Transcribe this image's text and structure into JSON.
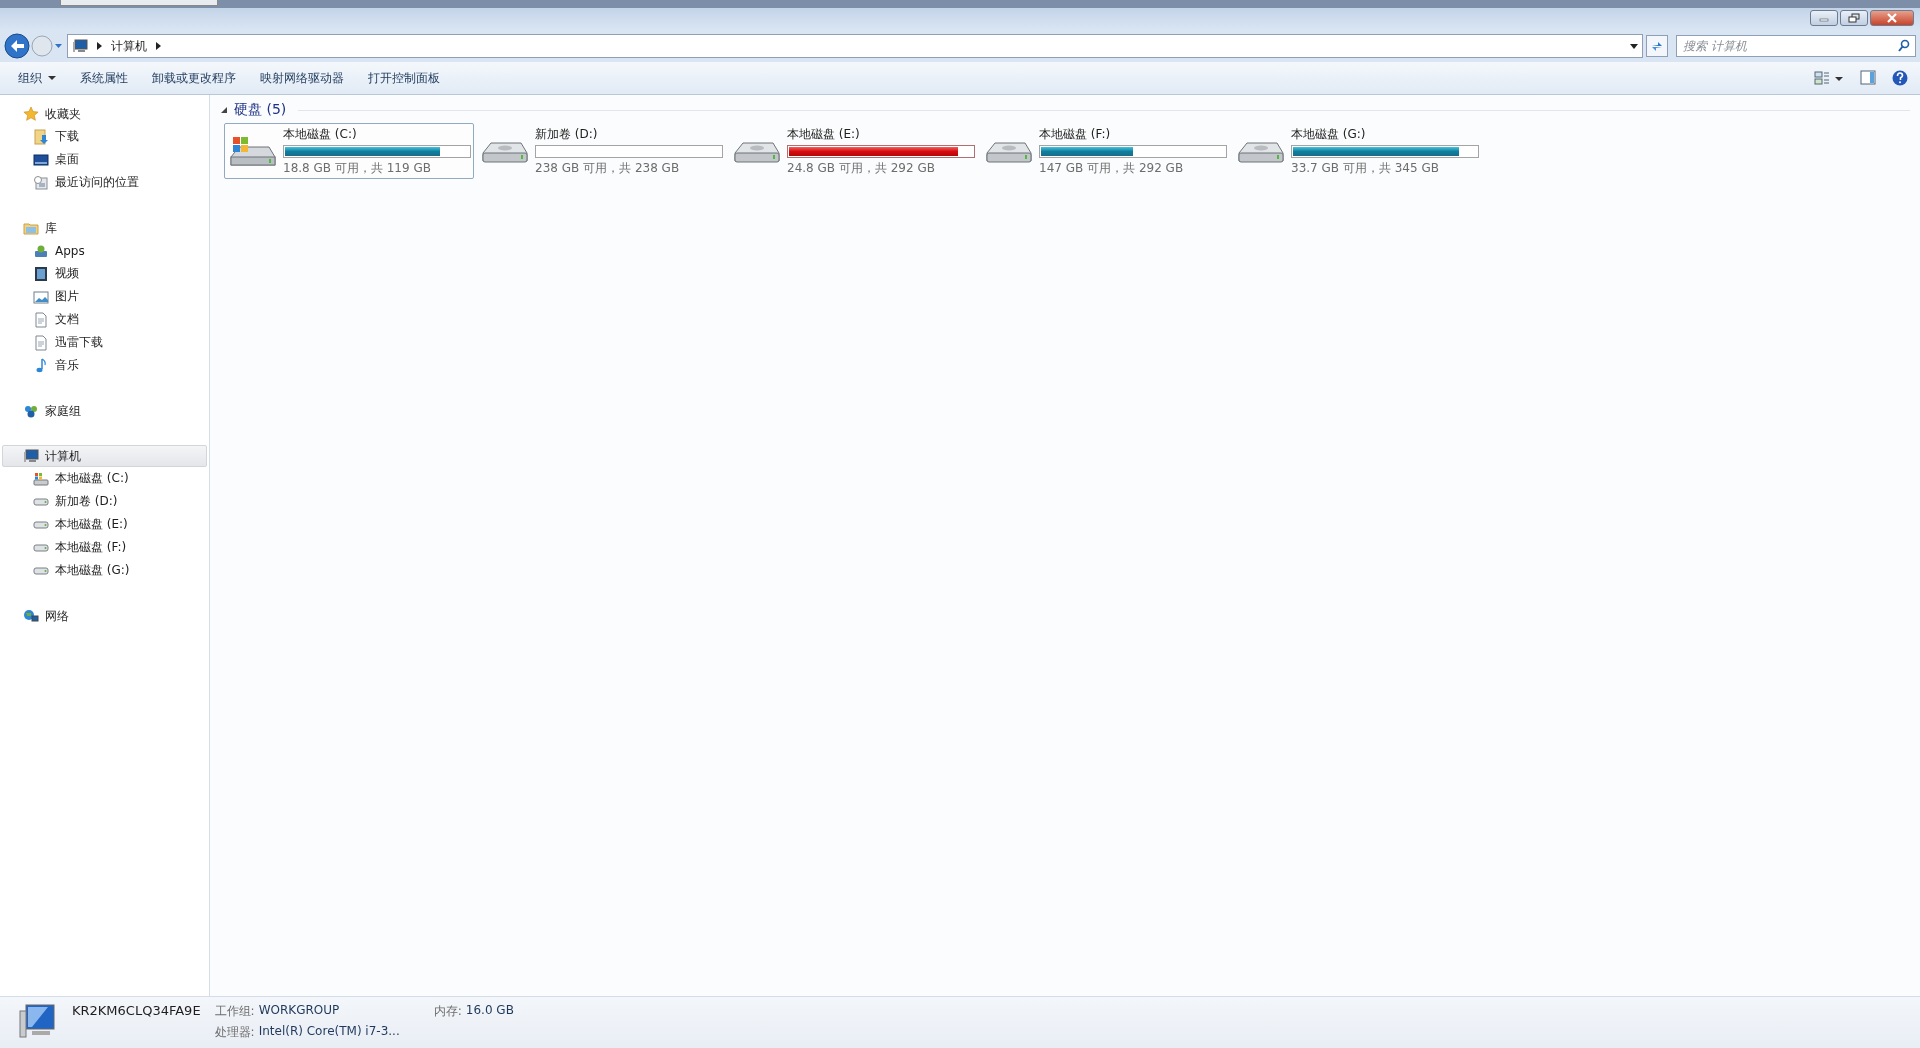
{
  "address_bar": {
    "path": [
      "计算机"
    ]
  },
  "search": {
    "placeholder": "搜索 计算机"
  },
  "toolbar": {
    "buttons": [
      {
        "label": "组织",
        "dropdown": true
      },
      {
        "label": "系统属性",
        "dropdown": false
      },
      {
        "label": "卸载或更改程序",
        "dropdown": false
      },
      {
        "label": "映射网络驱动器",
        "dropdown": false
      },
      {
        "label": "打开控制面板",
        "dropdown": false
      }
    ]
  },
  "sidebar": {
    "groups": [
      {
        "label": "收藏夹",
        "selected": false,
        "children": [
          {
            "label": "下载",
            "selected": false
          },
          {
            "label": "桌面",
            "selected": false
          },
          {
            "label": "最近访问的位置",
            "selected": false
          }
        ]
      },
      {
        "label": "库",
        "selected": false,
        "children": [
          {
            "label": "Apps",
            "selected": false
          },
          {
            "label": "视频",
            "selected": false
          },
          {
            "label": "图片",
            "selected": false
          },
          {
            "label": "文档",
            "selected": false
          },
          {
            "label": "迅雷下载",
            "selected": false
          },
          {
            "label": "音乐",
            "selected": false
          }
        ]
      },
      {
        "label": "家庭组",
        "selected": false
      },
      {
        "label": "计算机",
        "selected": true,
        "children": [
          {
            "label": "本地磁盘 (C:)",
            "selected": false
          },
          {
            "label": "新加卷 (D:)",
            "selected": false
          },
          {
            "label": "本地磁盘 (E:)",
            "selected": false
          },
          {
            "label": "本地磁盘 (F:)",
            "selected": false
          },
          {
            "label": "本地磁盘 (G:)",
            "selected": false
          }
        ]
      },
      {
        "label": "网络",
        "selected": false
      }
    ]
  },
  "content": {
    "section": {
      "title": "硬盘 (5)",
      "expanded": true
    },
    "drives": [
      {
        "name": "本地磁盘 (C:)",
        "kind": "system",
        "level": 0.84,
        "low_space": false,
        "info": "18.8 GB 可用，共 119 GB",
        "selected": true
      },
      {
        "name": "新加卷 (D:)",
        "kind": "data",
        "level": 0.0,
        "low_space": false,
        "info": "238 GB 可用，共 238 GB",
        "selected": false
      },
      {
        "name": "本地磁盘 (E:)",
        "kind": "data",
        "level": 0.92,
        "low_space": true,
        "info": "24.8 GB 可用，共 292 GB",
        "selected": false
      },
      {
        "name": "本地磁盘 (F:)",
        "kind": "data",
        "level": 0.5,
        "low_space": false,
        "info": "147 GB 可用，共 292 GB",
        "selected": false
      },
      {
        "name": "本地磁盘 (G:)",
        "kind": "data",
        "level": 0.9,
        "low_space": false,
        "info": "33.7 GB 可用，共 345 GB",
        "selected": false
      }
    ]
  },
  "status_bar": {
    "computer_name": "KR2KM6CLQ34FA9E",
    "details": [
      {
        "label": "工作组:",
        "value": "WORKGROUP"
      },
      {
        "label": "内存:",
        "value": "16.0 GB"
      },
      {
        "label": "处理器:",
        "value": "Intel(R) Core(TM) i7-3..."
      }
    ]
  }
}
